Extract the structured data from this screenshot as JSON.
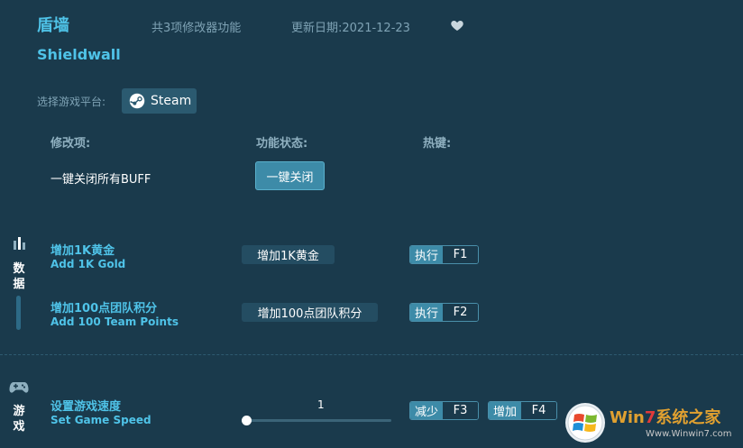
{
  "header": {
    "title_cn": "盾墙",
    "title_en": "Shieldwall",
    "feature_count": "共3项修改器功能",
    "update_date": "更新日期:2021-12-23"
  },
  "platform": {
    "label": "选择游戏平台:",
    "steam_label": "Steam"
  },
  "columns": {
    "mod": "修改项:",
    "state": "功能状态:",
    "hotkey": "热键:"
  },
  "one_key": {
    "label": "一键关闭所有BUFF",
    "button": "一键关闭"
  },
  "sections": {
    "data": {
      "chars": [
        "数",
        "据"
      ]
    },
    "game": {
      "chars": [
        "游",
        "戏"
      ]
    }
  },
  "items": [
    {
      "cn": "增加1K黄金",
      "en": "Add 1K Gold",
      "action": "增加1K黄金",
      "hotkey_action": "执行",
      "hotkey": "F1"
    },
    {
      "cn": "增加100点团队积分",
      "en": "Add 100 Team Points",
      "action": "增加100点团队积分",
      "hotkey_action": "执行",
      "hotkey": "F2"
    }
  ],
  "speed": {
    "cn": "设置游戏速度",
    "en": "Set Game Speed",
    "value": "1",
    "decrease_action": "减少",
    "decrease_key": "F3",
    "increase_action": "增加",
    "increase_key": "F4"
  },
  "watermark": {
    "brand_w": "Win",
    "brand_7": "7",
    "brand_rest": "系统之家",
    "url": "Www.Winwin7.com"
  },
  "colors": {
    "background": "#1a3a4c",
    "accent": "#4fc3e8",
    "button": "#3d8ba8"
  }
}
